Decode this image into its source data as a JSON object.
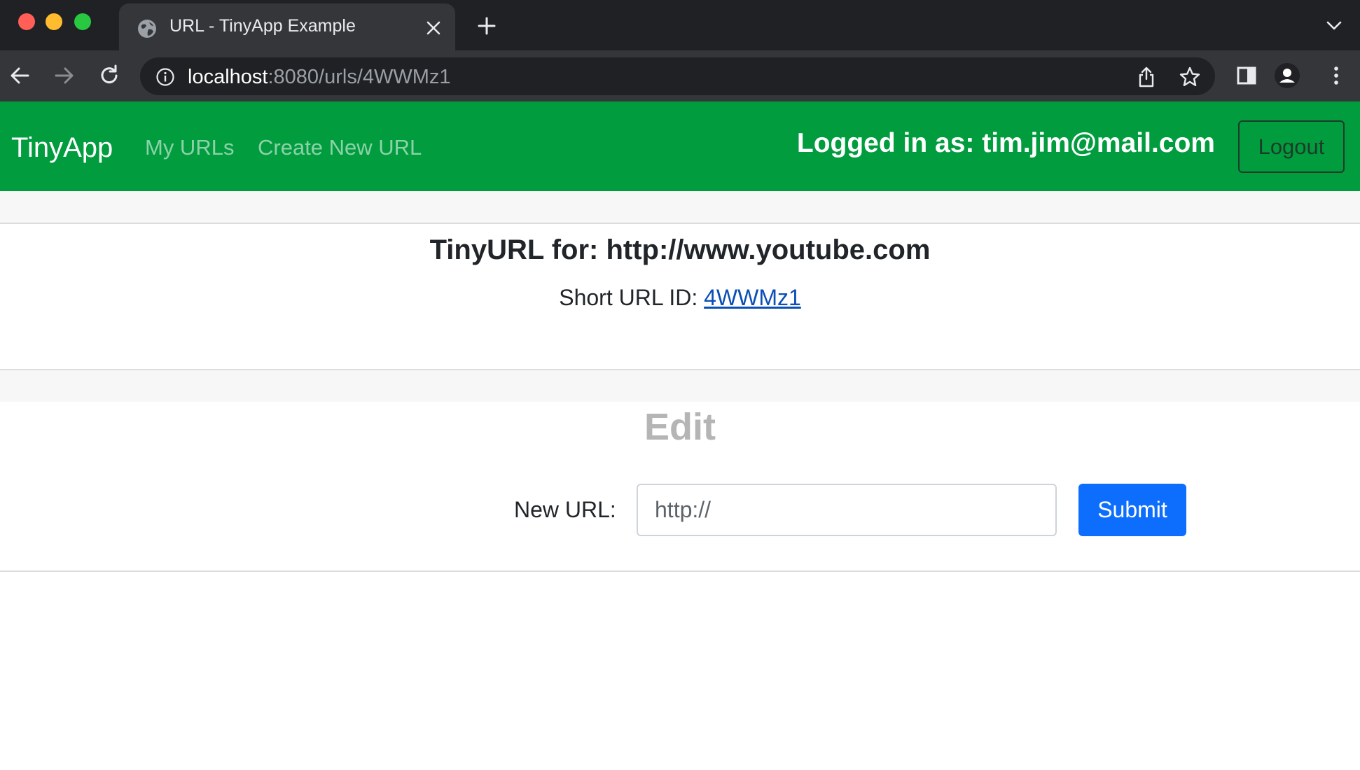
{
  "browser": {
    "tab": {
      "title": "URL - TinyApp Example",
      "favicon": "globe-icon"
    },
    "address_bar": {
      "host": "localhost",
      "rest": ":8080/urls/4WWMz1"
    },
    "icons": [
      "back-arrow-icon",
      "forward-arrow-icon",
      "reload-icon",
      "info-icon",
      "share-icon",
      "star-icon",
      "side-panel-icon",
      "profile-icon",
      "kebab-menu-icon",
      "plus-icon",
      "close-icon",
      "chevron-down-icon"
    ]
  },
  "navbar": {
    "brand": "TinyApp",
    "links": {
      "my_urls": "My URLs",
      "create_new": "Create New URL"
    },
    "logged_in_text": "Logged in as: tim.jim@mail.com",
    "logout_label": "Logout",
    "bg_color": "#009c3e"
  },
  "summary": {
    "title": "TinyURL for: http://www.youtube.com",
    "short_id_label": "Short URL ID:",
    "short_id": "4WWMz1"
  },
  "edit": {
    "title": "Edit",
    "new_url_label": "New URL:",
    "input_placeholder": "http://",
    "input_value": "",
    "submit_label": "Submit",
    "submit_color": "#0d6efd"
  }
}
